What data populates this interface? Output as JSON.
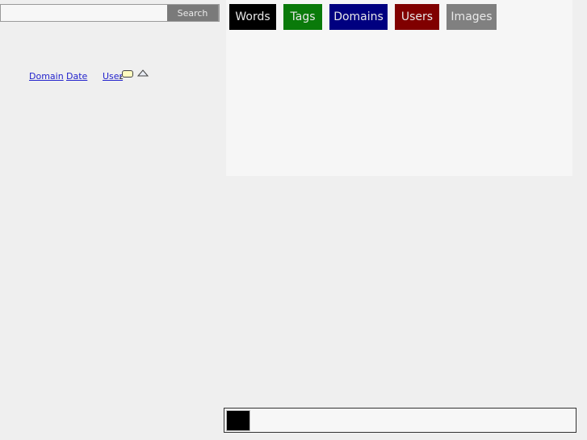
{
  "search": {
    "value": "",
    "placeholder": "",
    "button_label": "Search"
  },
  "sort": {
    "links": [
      {
        "label": "Domain"
      },
      {
        "label": "Date"
      },
      {
        "label": "User"
      }
    ],
    "icons": [
      "speech-bubble-icon",
      "up-triangle-icon"
    ]
  },
  "tabs": [
    {
      "label": "Words",
      "color": "#000000"
    },
    {
      "label": "Tags",
      "color": "#0a7a0a"
    },
    {
      "label": "Domains",
      "color": "#000080"
    },
    {
      "label": "Users",
      "color": "#800000"
    },
    {
      "label": "Images",
      "color": "#808080"
    }
  ],
  "bottom_bar": {
    "swatch_color": "#000000"
  }
}
